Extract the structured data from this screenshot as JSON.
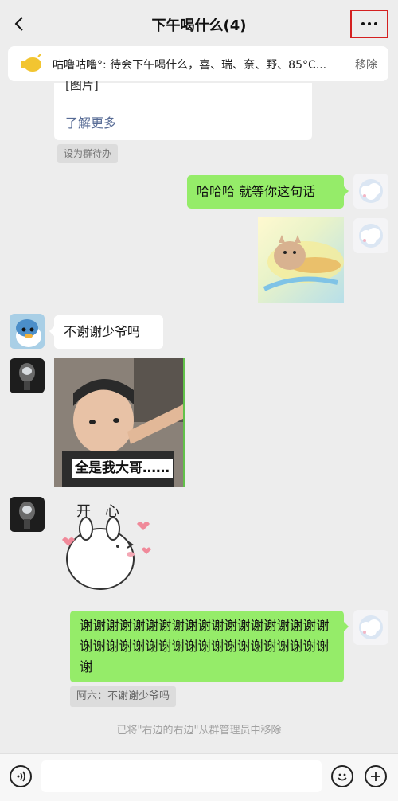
{
  "header": {
    "title": "下午喝什么(4)"
  },
  "pinned": {
    "text": "咕噜咕噜°: 待会下午喝什么，喜、瑞、奈、野、85°C...",
    "remove": "移除"
  },
  "messages": {
    "card_partial": "[图片]",
    "card_more": "了解更多",
    "todo_tag": "设为群待办",
    "msg_hahaha": "哈哈哈 就等你这句话",
    "msg_no_thanks": "不谢谢少爷吗",
    "meme_caption": "全是我大哥……",
    "sticker_text": "开心",
    "msg_thanks": "谢谢谢谢谢谢谢谢谢谢谢谢谢谢谢谢谢谢谢谢谢谢谢谢谢谢谢谢谢谢谢谢谢谢谢谢谢谢谢",
    "quote": "阿六：不谢谢少爷吗"
  },
  "system": {
    "notice": "已将\"右边的右边\"从群管理员中移除"
  },
  "input": {
    "value": ""
  },
  "colors": {
    "background": "#ededed",
    "green_bubble": "#95ec69",
    "highlight_box": "#d42020"
  }
}
